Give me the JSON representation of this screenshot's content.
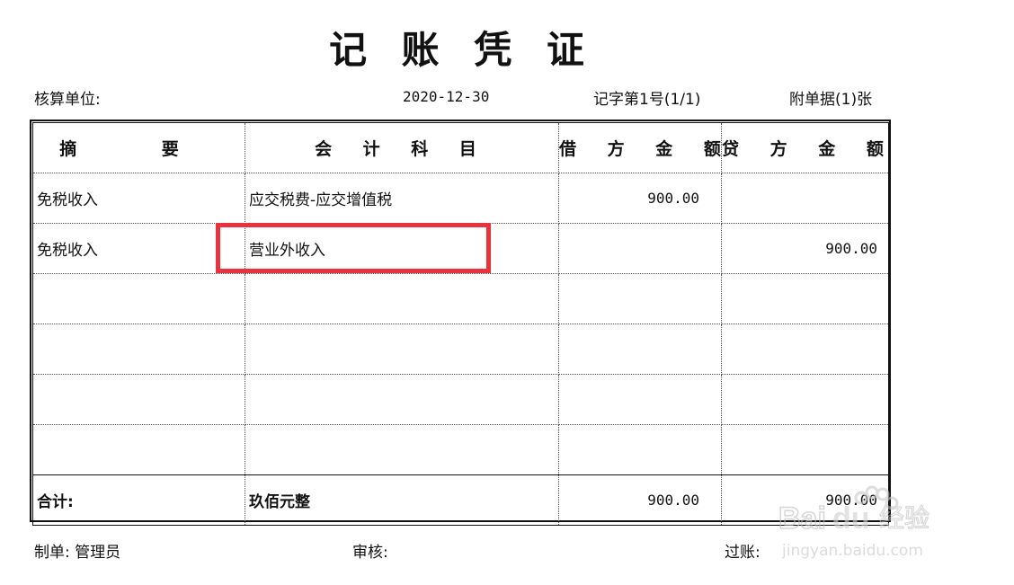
{
  "title": "记 账 凭 证",
  "meta": {
    "unit_label": "核算单位:",
    "date": "2020-12-30",
    "voucher_number": "记字第1号(1/1)",
    "attachments": "附单据(1)张"
  },
  "table": {
    "headers": {
      "summary": "摘 要",
      "account": "会 计 科 目",
      "debit": "借 方 金 额",
      "credit": "贷 方 金 额"
    },
    "rows": [
      {
        "summary": "免税收入",
        "account": "应交税费-应交增值税",
        "debit": "900.00",
        "credit": ""
      },
      {
        "summary": "免税收入",
        "account": "营业外收入",
        "debit": "",
        "credit": "900.00"
      },
      {
        "summary": "",
        "account": "",
        "debit": "",
        "credit": ""
      },
      {
        "summary": "",
        "account": "",
        "debit": "",
        "credit": ""
      },
      {
        "summary": "",
        "account": "",
        "debit": "",
        "credit": ""
      },
      {
        "summary": "",
        "account": "",
        "debit": "",
        "credit": ""
      }
    ],
    "total": {
      "label": "合计:",
      "amount_words": "玖佰元整",
      "debit": "900.00",
      "credit": "900.00"
    }
  },
  "footer": {
    "maker": "制单: 管理员",
    "reviewer": "审核:",
    "poster": "过账:"
  },
  "colors": {
    "highlight": "#e8323e"
  },
  "watermark": "Baidu经验 jingyan.baidu.com"
}
